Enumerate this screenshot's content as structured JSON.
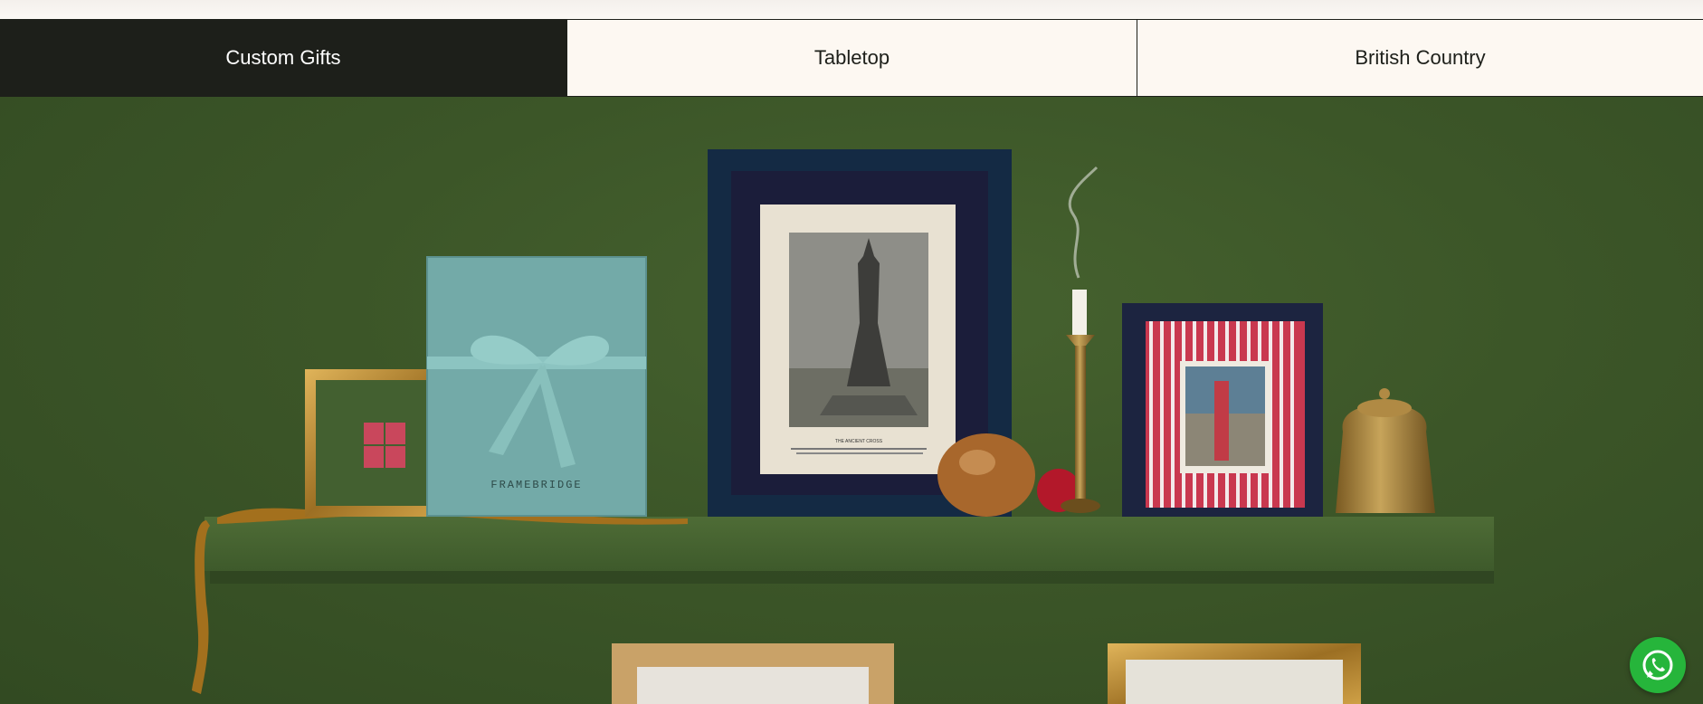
{
  "tabs": [
    {
      "label": "Custom Gifts",
      "active": true
    },
    {
      "label": "Tabletop",
      "active": false
    },
    {
      "label": "British Country",
      "active": false
    }
  ],
  "hero": {
    "gift_box_brand": "FRAMEBRIDGE",
    "print_title": "THE ANCIENT CROSS"
  },
  "colors": {
    "active_tab_bg": "#1d1f1a",
    "tab_bg": "#fdf8f2",
    "wall_green": "#3c5628",
    "whatsapp_green": "#26b53b"
  },
  "icons": {
    "chat": "whatsapp-icon"
  }
}
